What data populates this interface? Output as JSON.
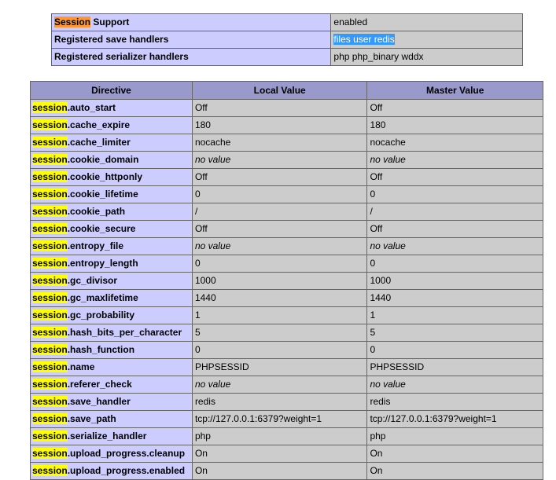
{
  "support": {
    "rows": [
      {
        "key_prefix": "Session",
        "key_rest": " Support",
        "value": "enabled"
      },
      {
        "key": "Registered save handlers",
        "value": "files user redis"
      },
      {
        "key": "Registered serializer handlers",
        "value": "php php_binary wddx"
      }
    ]
  },
  "directives": {
    "headers": [
      "Directive",
      "Local Value",
      "Master Value"
    ],
    "prefix": "session",
    "rows": [
      {
        "name": ".auto_start",
        "local": "Off",
        "master": "Off"
      },
      {
        "name": ".cache_expire",
        "local": "180",
        "master": "180"
      },
      {
        "name": ".cache_limiter",
        "local": "nocache",
        "master": "nocache"
      },
      {
        "name": ".cookie_domain",
        "local": "no value",
        "master": "no value",
        "no_value": true
      },
      {
        "name": ".cookie_httponly",
        "local": "Off",
        "master": "Off"
      },
      {
        "name": ".cookie_lifetime",
        "local": "0",
        "master": "0"
      },
      {
        "name": ".cookie_path",
        "local": "/",
        "master": "/"
      },
      {
        "name": ".cookie_secure",
        "local": "Off",
        "master": "Off"
      },
      {
        "name": ".entropy_file",
        "local": "no value",
        "master": "no value",
        "no_value": true
      },
      {
        "name": ".entropy_length",
        "local": "0",
        "master": "0"
      },
      {
        "name": ".gc_divisor",
        "local": "1000",
        "master": "1000"
      },
      {
        "name": ".gc_maxlifetime",
        "local": "1440",
        "master": "1440"
      },
      {
        "name": ".gc_probability",
        "local": "1",
        "master": "1"
      },
      {
        "name": ".hash_bits_per_character",
        "local": "5",
        "master": "5"
      },
      {
        "name": ".hash_function",
        "local": "0",
        "master": "0"
      },
      {
        "name": ".name",
        "local": "PHPSESSID",
        "master": "PHPSESSID"
      },
      {
        "name": ".referer_check",
        "local": "no value",
        "master": "no value",
        "no_value": true
      },
      {
        "name": ".save_handler",
        "local": "redis",
        "master": "redis"
      },
      {
        "name": ".save_path",
        "local": "tcp://127.0.0.1:6379?weight=1",
        "master": "tcp://127.0.0.1:6379?weight=1"
      },
      {
        "name": ".serialize_handler",
        "local": "php",
        "master": "php"
      },
      {
        "name": ".upload_progress.cleanup",
        "local": "On",
        "master": "On"
      },
      {
        "name": ".upload_progress.enabled",
        "local": "On",
        "master": "On"
      }
    ]
  },
  "colors": {
    "header_bg": "#9999cc",
    "key_bg": "#ccccff",
    "value_bg": "#cccccc",
    "search_highlight": "#ffff00",
    "current_match": "#ff9632",
    "selection": "#3399ff"
  }
}
